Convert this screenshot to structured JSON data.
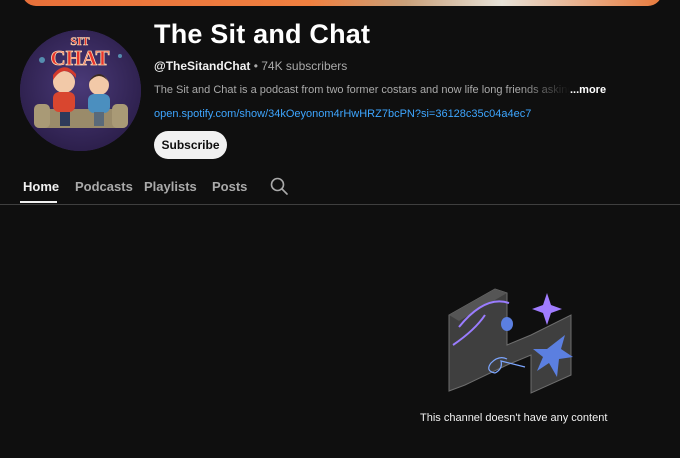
{
  "channel": {
    "name": "The Sit and Chat",
    "handle": "@TheSitandChat",
    "separator": " • ",
    "subscribers": "74K subscribers",
    "description": "The Sit and Chat is a podcast from two former costars and now life long friends asking gi",
    "more_label": "...more",
    "link": "open.spotify.com/show/34kOeyonom4rHwHRZ7bcPN?si=36128c35c04a4ec7",
    "subscribe_label": "Subscribe",
    "avatar_logo_text": [
      "SIT",
      "CHAT"
    ]
  },
  "tabs": [
    {
      "label": "Home",
      "active": true
    },
    {
      "label": "Podcasts",
      "active": false
    },
    {
      "label": "Playlists",
      "active": false
    },
    {
      "label": "Posts",
      "active": false
    }
  ],
  "icons": {
    "search": "search-icon"
  },
  "empty_state": {
    "message": "This channel doesn't have any content"
  },
  "colors": {
    "background": "#0f0f0f",
    "link": "#3ea6ff",
    "text": "#f1f1f1",
    "secondary": "#aaaaaa"
  }
}
